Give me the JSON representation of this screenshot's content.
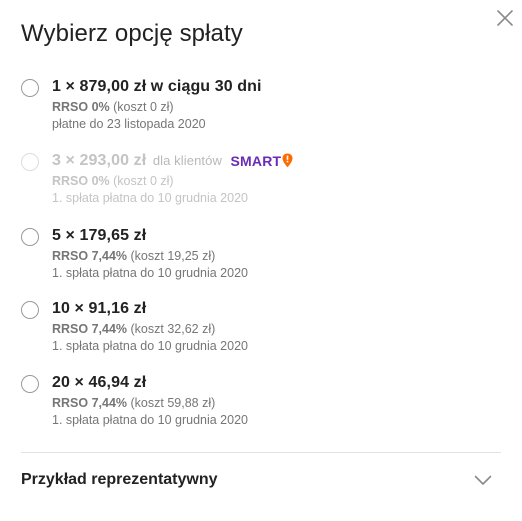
{
  "dialog": {
    "title": "Wybierz opcję spłaty",
    "close_icon": "close-icon"
  },
  "options": [
    {
      "main": "1 × 879,00 zł w ciągu 30 dni",
      "rrso_label": "RRSO 0%",
      "cost": "(koszt 0 zł)",
      "due": "płatne do 23 listopada 2020",
      "disabled": false
    },
    {
      "main": "3 × 293,00 zł",
      "suffix": "dla klientów",
      "logo_text": "SMART",
      "rrso_label": "RRSO 0%",
      "cost": "(koszt 0 zł)",
      "due": "1. spłata płatna do 10 grudnia 2020",
      "disabled": true
    },
    {
      "main": "5 × 179,65 zł",
      "rrso_label": "RRSO 7,44%",
      "cost": "(koszt 19,25 zł)",
      "due": "1. spłata płatna do 10 grudnia 2020",
      "disabled": false
    },
    {
      "main": "10 × 91,16 zł",
      "rrso_label": "RRSO 7,44%",
      "cost": "(koszt 32,62 zł)",
      "due": "1. spłata płatna do 10 grudnia 2020",
      "disabled": false
    },
    {
      "main": "20 × 46,94 zł",
      "rrso_label": "RRSO 7,44%",
      "cost": "(koszt 59,88 zł)",
      "due": "1. spłata płatna do 10 grudnia 2020",
      "disabled": false
    }
  ],
  "accordion": {
    "label": "Przykład reprezentatywny",
    "icon": "chevron-down-icon"
  },
  "colors": {
    "smart_purple": "#6b2ab8",
    "smart_orange": "#ff6a00",
    "disabled_text": "#c4c4c4",
    "secondary_text": "#767676"
  }
}
